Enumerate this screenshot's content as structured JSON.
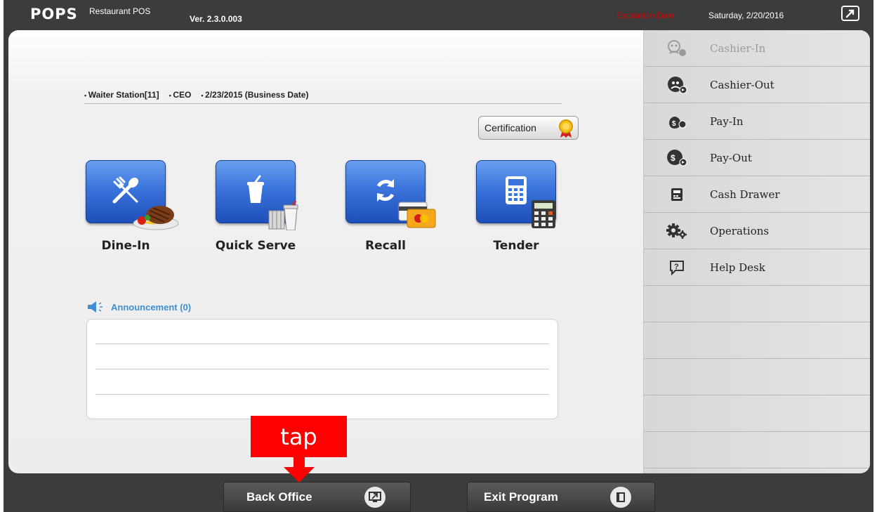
{
  "header": {
    "logo": "POPS",
    "logo_sub": "Restaurant POS",
    "version": "Ver. 2.3.0.003",
    "expiration_label": "Expiration Date",
    "expiration_date": "Saturday, 2/20/2016"
  },
  "info": {
    "station": "Waiter Station[11]",
    "user": "CEO",
    "business_date": "2/23/2015 (Business Date)"
  },
  "certification_label": "Certification",
  "tiles": [
    {
      "label": "Dine-In",
      "icon": "fork-knife-icon"
    },
    {
      "label": "Quick Serve",
      "icon": "drink-cup-icon"
    },
    {
      "label": "Recall",
      "icon": "refresh-icon"
    },
    {
      "label": "Tender",
      "icon": "calculator-icon"
    }
  ],
  "announcement": {
    "title": "Announcement (0)",
    "count": 0
  },
  "side_menu": [
    {
      "label": "Cashier-In",
      "icon": "cashier-in-icon",
      "enabled": false
    },
    {
      "label": "Cashier-Out",
      "icon": "cashier-out-icon",
      "enabled": true
    },
    {
      "label": "Pay-In",
      "icon": "pay-in-icon",
      "enabled": true
    },
    {
      "label": "Pay-Out",
      "icon": "pay-out-icon",
      "enabled": true
    },
    {
      "label": "Cash Drawer",
      "icon": "cash-drawer-icon",
      "enabled": true
    },
    {
      "label": "Operations",
      "icon": "gears-icon",
      "enabled": true
    },
    {
      "label": "Help Desk",
      "icon": "help-desk-icon",
      "enabled": true
    }
  ],
  "bottom": {
    "back_office": "Back Office",
    "exit_program": "Exit Program"
  },
  "annotation": {
    "tap": "tap"
  },
  "colors": {
    "accent_blue": "#3b74dc",
    "expiration_red": "#d40000",
    "annotation_red": "#ff0000"
  }
}
